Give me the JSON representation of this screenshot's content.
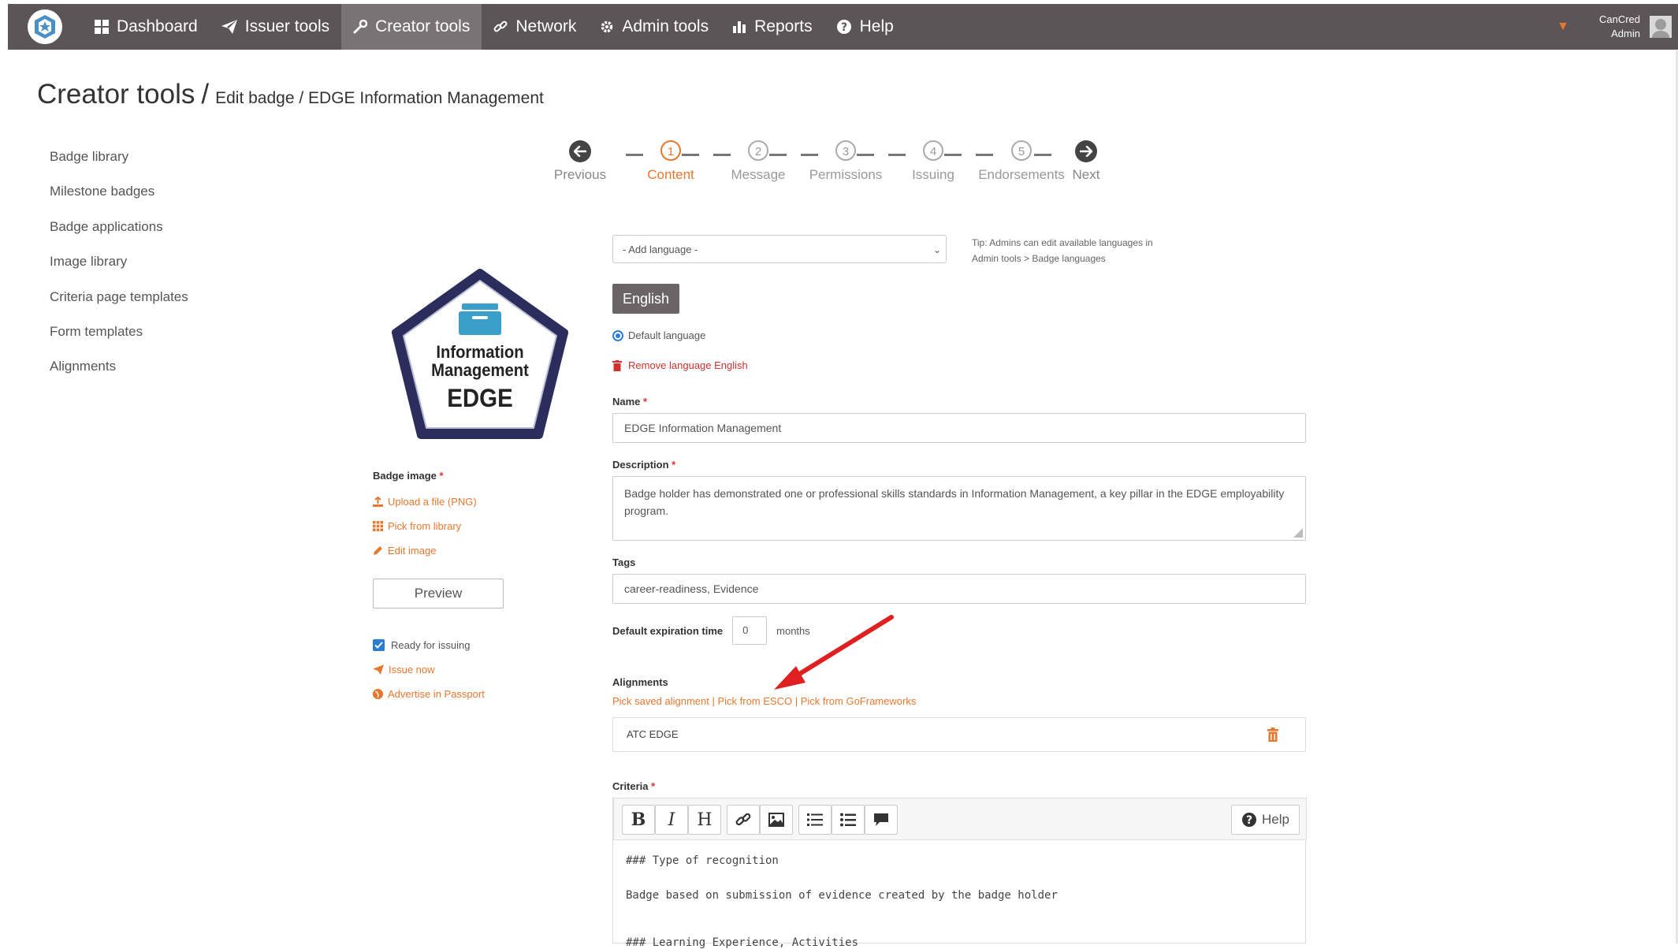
{
  "nav": {
    "items": [
      {
        "label": "Dashboard",
        "icon": "dashboard-icon"
      },
      {
        "label": "Issuer tools",
        "icon": "paper-plane-icon"
      },
      {
        "label": "Creator tools",
        "icon": "wrench-icon",
        "active": true
      },
      {
        "label": "Network",
        "icon": "link-icon"
      },
      {
        "label": "Admin tools",
        "icon": "gear-icon"
      },
      {
        "label": "Reports",
        "icon": "bar-chart-icon"
      },
      {
        "label": "Help",
        "icon": "question-circle-icon"
      }
    ],
    "user_org": "CanCred",
    "user_role": "Admin"
  },
  "title": {
    "main": "Creator tools",
    "separator": "/",
    "sub": "Edit badge / EDGE Information Management"
  },
  "sidebar": {
    "items": [
      {
        "label": "Badge library"
      },
      {
        "label": "Milestone badges"
      },
      {
        "label": "Badge applications"
      },
      {
        "label": "Image library"
      },
      {
        "label": "Criteria page templates"
      },
      {
        "label": "Form templates"
      },
      {
        "label": "Alignments"
      }
    ]
  },
  "stepper": {
    "previous": "Previous",
    "next": "Next",
    "steps": [
      {
        "num": "1",
        "label": "Content",
        "active": true
      },
      {
        "num": "2",
        "label": "Message"
      },
      {
        "num": "3",
        "label": "Permissions"
      },
      {
        "num": "4",
        "label": "Issuing"
      },
      {
        "num": "5",
        "label": "Endorsements"
      }
    ]
  },
  "badge": {
    "line1": "Information",
    "line2": "Management",
    "line3": "EDGE",
    "image_label": "Badge image",
    "upload": "Upload a file (PNG)",
    "pick": "Pick from library",
    "edit": "Edit image",
    "preview": "Preview",
    "ready": "Ready for issuing",
    "issue_now": "Issue now",
    "advertise": "Advertise in Passport"
  },
  "form": {
    "add_language": "- Add language -",
    "tip_line1": "Tip: Admins can edit available languages in",
    "tip_line2": "Admin tools > Badge languages",
    "language_tab": "English",
    "default_language": "Default language",
    "remove_language": "Remove language English",
    "name_label": "Name",
    "name_value": "EDGE Information Management",
    "description_label": "Description",
    "description_value": "Badge holder has demonstrated one or professional skills standards in Information Management, a key pillar in the EDGE employability program.",
    "tags_label": "Tags",
    "tags_value": "career-readiness, Evidence",
    "expiration_label": "Default expiration time",
    "expiration_value": "0",
    "expiration_unit": "months",
    "alignments_label": "Alignments",
    "pick_saved": "Pick saved alignment",
    "pick_esco": "Pick from ESCO",
    "pick_goframeworks": "Pick from GoFrameworks",
    "alignment_item": "ATC EDGE",
    "criteria_label": "Criteria",
    "help": "Help",
    "toolbar": {
      "bold": "B",
      "italic": "I",
      "heading": "H"
    },
    "criteria_line1": "### Type of recognition",
    "criteria_line2": "Badge based on submission of evidence created by the badge holder",
    "criteria_line3": "### Learning Experience, Activities"
  },
  "colors": {
    "nav_bg": "#5c5558",
    "nav_active": "#7a7376",
    "accent_orange": "#e8772e",
    "danger_red": "#d0312d",
    "badge_navy": "#2b2d5c",
    "badge_teal": "#3a9fc9",
    "annotation_arrow": "#e02020"
  }
}
